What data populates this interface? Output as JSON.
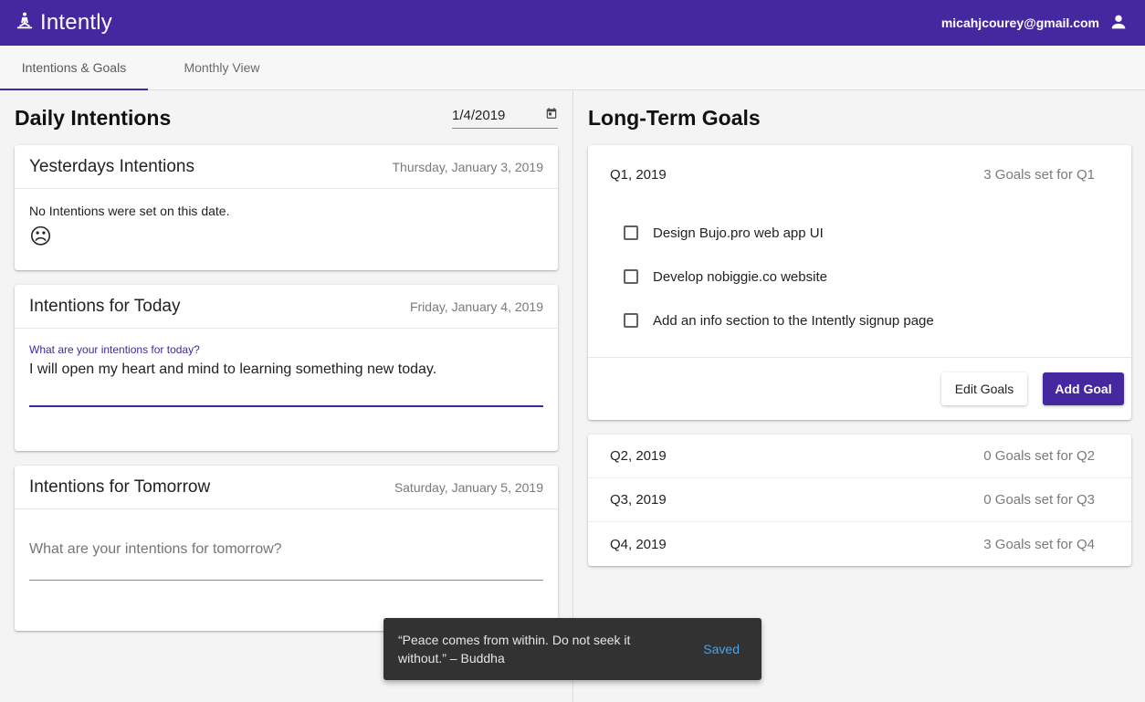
{
  "header": {
    "title": "Intently",
    "email": "micahjcourey@gmail.com"
  },
  "tabs": [
    {
      "label": "Intentions & Goals",
      "active": true
    },
    {
      "label": "Monthly View",
      "active": false
    }
  ],
  "daily": {
    "heading": "Daily Intentions",
    "date_value": "1/4/2019",
    "yesterday": {
      "title": "Yesterdays Intentions",
      "date": "Thursday, January 3, 2019",
      "empty_text": "No Intentions were set on this date.",
      "emoji": "☹"
    },
    "today": {
      "title": "Intentions for Today",
      "date": "Friday, January 4, 2019",
      "field_label": "What are your intentions for today?",
      "value": "I will open my heart and mind to learning something new today."
    },
    "tomorrow": {
      "title": "Intentions for Tomorrow",
      "date": "Saturday, January 5, 2019",
      "placeholder": "What are your intentions for tomorrow?"
    }
  },
  "goals": {
    "heading": "Long-Term Goals",
    "q1": {
      "label": "Q1, 2019",
      "count": "3 Goals set for Q1",
      "items": [
        "Design Bujo.pro web app UI",
        "Develop nobiggie.co website",
        "Add an info section to the Intently signup page"
      ],
      "edit_label": "Edit Goals",
      "add_label": "Add Goal"
    },
    "quarters": [
      {
        "label": "Q2, 2019",
        "count": "0 Goals set for Q2"
      },
      {
        "label": "Q3, 2019",
        "count": "0 Goals set for Q3"
      },
      {
        "label": "Q4, 2019",
        "count": "3 Goals set for Q4"
      }
    ]
  },
  "snackbar": {
    "message": "“Peace comes from within. Do not seek it without.” – Buddha",
    "action": "Saved"
  },
  "colors": {
    "primary": "#4527a0",
    "snackbar_bg": "#323232",
    "snackbar_action": "#42a5f5"
  },
  "icons": {
    "brand": "meditation-icon",
    "account": "person-icon",
    "calendar": "calendar-icon"
  }
}
